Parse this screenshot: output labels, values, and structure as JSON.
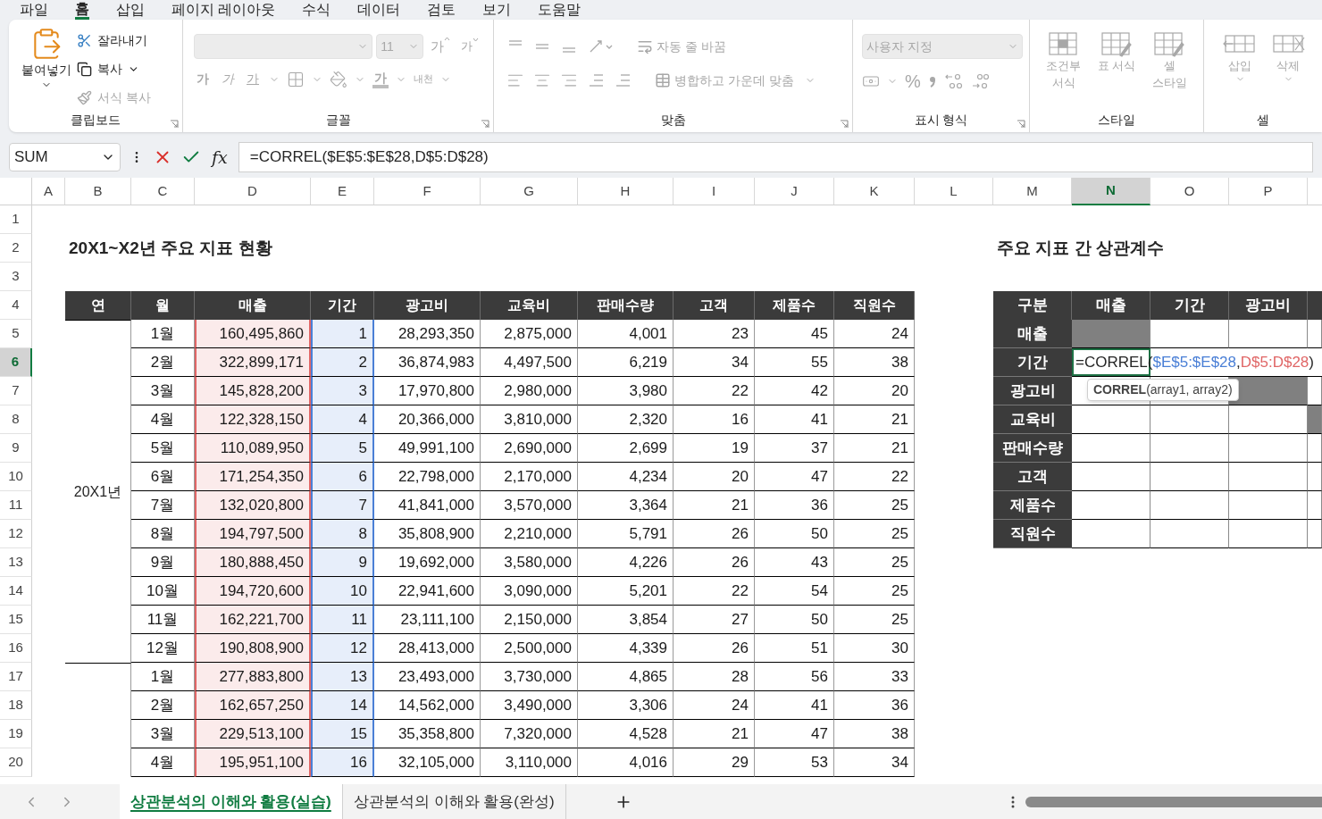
{
  "menu_tabs": [
    {
      "label": "파일",
      "selected": false
    },
    {
      "label": "홈",
      "selected": true
    },
    {
      "label": "삽입",
      "selected": false
    },
    {
      "label": "페이지 레이아웃",
      "selected": false
    },
    {
      "label": "수식",
      "selected": false
    },
    {
      "label": "데이터",
      "selected": false
    },
    {
      "label": "검토",
      "selected": false
    },
    {
      "label": "보기",
      "selected": false
    },
    {
      "label": "도움말",
      "selected": false
    }
  ],
  "ribbon": {
    "groups": [
      {
        "kind": "clipboard",
        "label": "클립보드",
        "paste": {
          "label": "붙여넣기",
          "disabled": false
        },
        "items": [
          {
            "label": "잘라내기",
            "disabled": false
          },
          {
            "label": "복사",
            "disabled": false
          },
          {
            "label": "서식 복사",
            "disabled": true
          }
        ]
      },
      {
        "kind": "font",
        "label": "글꼴",
        "disabled": true,
        "size": "11",
        "grow": "가",
        "shrink": "가",
        "bold": "가",
        "italic": "가",
        "underline": "가",
        "font_color": "가",
        "phonetic": "내천"
      },
      {
        "kind": "alignment",
        "label": "맞춤",
        "disabled": true,
        "wrap": "자동 줄 바꿈",
        "merge": "병합하고 가운데 맞춤"
      },
      {
        "kind": "number",
        "label": "표시 형식",
        "disabled": true,
        "format": "사용자 지정",
        "percent": "%"
      },
      {
        "kind": "styles",
        "label": "스타일",
        "disabled": true,
        "items": [
          "조건부 서식",
          "표 서식",
          "셀 스타일"
        ]
      },
      {
        "kind": "cells",
        "label": "셀",
        "disabled": true,
        "items": [
          "삽입",
          "삭제"
        ]
      }
    ]
  },
  "formula_bar": {
    "name_box": "SUM",
    "function_label": "fx",
    "formula": "=CORREL($E$5:$E$28,D$5:D$28)"
  },
  "sheet": {
    "columns": [
      {
        "label": "A",
        "selected": false
      },
      {
        "label": "B",
        "selected": false
      },
      {
        "label": "C",
        "selected": false
      },
      {
        "label": "D",
        "selected": false
      },
      {
        "label": "E",
        "selected": false
      },
      {
        "label": "F",
        "selected": false
      },
      {
        "label": "G",
        "selected": false
      },
      {
        "label": "H",
        "selected": false
      },
      {
        "label": "I",
        "selected": false
      },
      {
        "label": "J",
        "selected": false
      },
      {
        "label": "K",
        "selected": false
      },
      {
        "label": "L",
        "selected": false
      },
      {
        "label": "M",
        "selected": false
      },
      {
        "label": "N",
        "selected": true
      },
      {
        "label": "O",
        "selected": false
      },
      {
        "label": "P",
        "selected": false
      }
    ],
    "rows": [
      {
        "label": "1",
        "selected": false
      },
      {
        "label": "2",
        "selected": false
      },
      {
        "label": "3",
        "selected": false
      },
      {
        "label": "4",
        "selected": false
      },
      {
        "label": "5",
        "selected": false
      },
      {
        "label": "6",
        "selected": true
      },
      {
        "label": "7",
        "selected": false
      },
      {
        "label": "8",
        "selected": false
      },
      {
        "label": "9",
        "selected": false
      },
      {
        "label": "10",
        "selected": false
      },
      {
        "label": "11",
        "selected": false
      },
      {
        "label": "12",
        "selected": false
      },
      {
        "label": "13",
        "selected": false
      },
      {
        "label": "14",
        "selected": false
      },
      {
        "label": "15",
        "selected": false
      },
      {
        "label": "16",
        "selected": false
      },
      {
        "label": "17",
        "selected": false
      },
      {
        "label": "18",
        "selected": false
      },
      {
        "label": "19",
        "selected": false
      },
      {
        "label": "20",
        "selected": false
      }
    ],
    "title_left": "20X1~X2년 주요 지표 현황",
    "title_right": "주요 지표 간 상관계수",
    "main_table": {
      "columns": [
        {
          "label": "연"
        },
        {
          "label": "월"
        },
        {
          "label": "매출",
          "color": "#e06666"
        },
        {
          "label": "기간",
          "color": "#4a7fd6"
        },
        {
          "label": "광고비"
        },
        {
          "label": "교육비"
        },
        {
          "label": "판매수량"
        },
        {
          "label": "고객"
        },
        {
          "label": "제품수"
        },
        {
          "label": "직원수"
        }
      ],
      "groups": [
        {
          "label": "20X1년",
          "rows": [
            [
              "1월",
              "160,495,860",
              "1",
              "28,293,350",
              "2,875,000",
              "4,001",
              "23",
              "45",
              "24"
            ],
            [
              "2월",
              "322,899,171",
              "2",
              "36,874,983",
              "4,497,500",
              "6,219",
              "34",
              "55",
              "38"
            ],
            [
              "3월",
              "145,828,200",
              "3",
              "17,970,800",
              "2,980,000",
              "3,980",
              "22",
              "42",
              "20"
            ],
            [
              "4월",
              "122,328,150",
              "4",
              "20,366,000",
              "3,810,000",
              "2,320",
              "16",
              "41",
              "21"
            ],
            [
              "5월",
              "110,089,950",
              "5",
              "49,991,100",
              "2,690,000",
              "2,699",
              "19",
              "37",
              "21"
            ],
            [
              "6월",
              "171,254,350",
              "6",
              "22,798,000",
              "2,170,000",
              "4,234",
              "20",
              "47",
              "22"
            ],
            [
              "7월",
              "132,020,800",
              "7",
              "41,841,000",
              "3,570,000",
              "3,364",
              "21",
              "36",
              "25"
            ],
            [
              "8월",
              "194,797,500",
              "8",
              "35,808,900",
              "2,210,000",
              "5,791",
              "26",
              "50",
              "25"
            ],
            [
              "9월",
              "180,888,450",
              "9",
              "19,692,000",
              "3,580,000",
              "4,226",
              "26",
              "43",
              "25"
            ],
            [
              "10월",
              "194,720,600",
              "10",
              "22,941,600",
              "3,090,000",
              "5,201",
              "22",
              "54",
              "25"
            ],
            [
              "11월",
              "162,221,700",
              "11",
              "23,111,100",
              "2,150,000",
              "3,854",
              "27",
              "50",
              "25"
            ],
            [
              "12월",
              "190,808,900",
              "12",
              "28,413,000",
              "2,500,000",
              "4,339",
              "26",
              "51",
              "30"
            ]
          ]
        },
        {
          "rows": [
            [
              "1월",
              "277,883,800",
              "13",
              "23,493,000",
              "3,730,000",
              "4,865",
              "28",
              "56",
              "33"
            ],
            [
              "2월",
              "162,657,250",
              "14",
              "14,562,000",
              "3,490,000",
              "3,306",
              "24",
              "41",
              "36"
            ],
            [
              "3월",
              "229,513,100",
              "15",
              "35,358,800",
              "7,320,000",
              "4,528",
              "21",
              "47",
              "38"
            ],
            [
              "4월",
              "195,951,100",
              "16",
              "32,105,000",
              "3,110,000",
              "4,016",
              "29",
              "53",
              "34"
            ]
          ]
        }
      ]
    },
    "corr_table": {
      "columns": [
        "구분",
        "매출",
        "기간",
        "광고비"
      ],
      "rows": [
        {
          "label": "매출",
          "editing": false,
          "cells": [
            {
              "shaded": true
            },
            {
              "shaded": false
            },
            {
              "shaded": false
            },
            {
              "shaded": false
            }
          ]
        },
        {
          "label": "기간",
          "editing": true,
          "cells": []
        },
        {
          "label": "광고비",
          "editing": false,
          "cells": [
            {
              "shaded": false
            },
            {
              "shaded": false
            },
            {
              "shaded": true
            },
            {
              "shaded": false
            }
          ]
        },
        {
          "label": "교육비",
          "editing": false,
          "cells": [
            {
              "shaded": false
            },
            {
              "shaded": false
            },
            {
              "shaded": false
            },
            {
              "shaded": true
            }
          ]
        },
        {
          "label": "판매수량",
          "editing": false,
          "cells": [
            {
              "shaded": false
            },
            {
              "shaded": false
            },
            {
              "shaded": false
            },
            {
              "shaded": false
            }
          ]
        },
        {
          "label": "고객",
          "editing": false,
          "cells": [
            {
              "shaded": false
            },
            {
              "shaded": false
            },
            {
              "shaded": false
            },
            {
              "shaded": false
            }
          ]
        },
        {
          "label": "제품수",
          "editing": false,
          "cells": [
            {
              "shaded": false
            },
            {
              "shaded": false
            },
            {
              "shaded": false
            },
            {
              "shaded": false
            }
          ]
        },
        {
          "label": "직원수",
          "editing": false,
          "cells": [
            {
              "shaded": false
            },
            {
              "shaded": false
            },
            {
              "shaded": false
            },
            {
              "shaded": false
            }
          ]
        }
      ],
      "editor": [
        {
          "text": "=CORREL("
        },
        {
          "text": "$E$5:$E$28",
          "color": "#4a7fd6"
        },
        {
          "text": ","
        },
        {
          "text": "D$5:D$28",
          "color": "#e06666"
        },
        {
          "text": ")"
        }
      ],
      "tooltip": "**CORREL**(array1, array2)"
    }
  },
  "sheet_tabs": [
    {
      "label": "상관분석의 이해와 활용(실습)",
      "selected": true
    },
    {
      "label": "상관분석의 이해와 활용(완성)",
      "selected": false
    }
  ]
}
